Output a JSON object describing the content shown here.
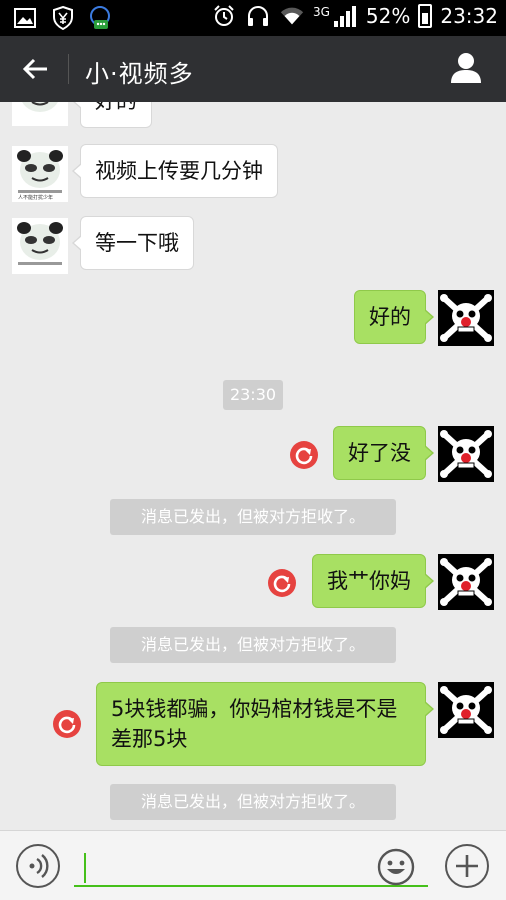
{
  "status_bar": {
    "battery": "52%",
    "time": "23:32",
    "network": "3G"
  },
  "header": {
    "title": "小·视频多"
  },
  "messages": [
    {
      "side": "left",
      "text": "好的"
    },
    {
      "side": "left",
      "text": "视频上传要几分钟"
    },
    {
      "side": "left",
      "text": "等一下哦"
    },
    {
      "side": "right",
      "text": "好的"
    },
    {
      "side": "right",
      "text": "好了没"
    },
    {
      "side": "right",
      "text": "我艹你妈"
    },
    {
      "side": "right",
      "text": "5块钱都骗，你妈棺材钱是不是差那5块"
    }
  ],
  "timestamp": "23:30",
  "system_note": "消息已发出，但被对方拒收了。",
  "panda_caption": "人不能打扰少年",
  "colors": {
    "accent": "#45c01a",
    "bubble_right": "#a8e063",
    "header_bg": "#2f3033",
    "error": "#e64340"
  }
}
